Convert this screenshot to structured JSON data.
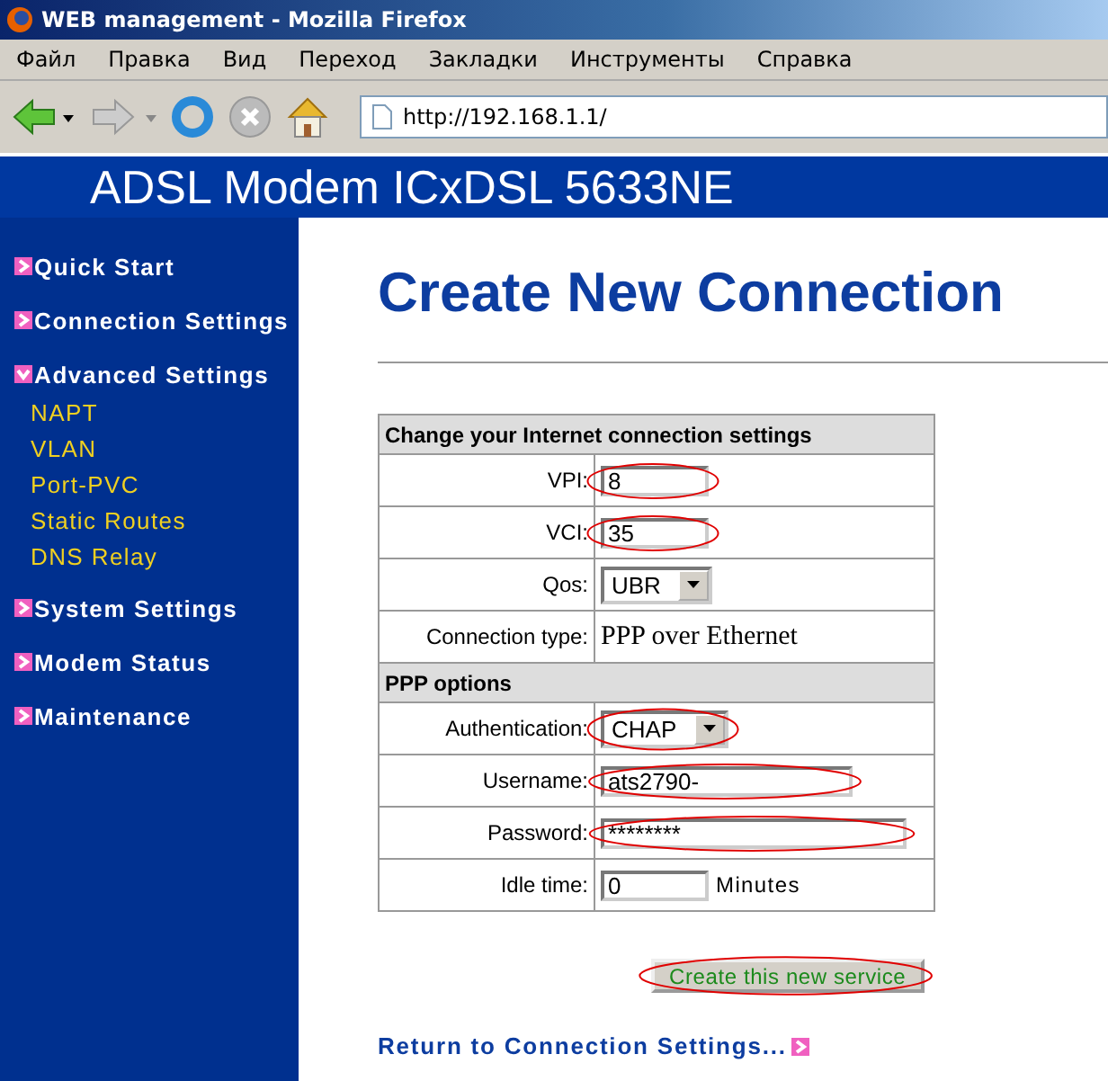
{
  "window": {
    "title": "WEB management - Mozilla Firefox"
  },
  "menu_bar": [
    "Файл",
    "Правка",
    "Вид",
    "Переход",
    "Закладки",
    "Инструменты",
    "Справка"
  ],
  "address_bar": {
    "value": "http://192.168.1.1/"
  },
  "header": {
    "title": "ADSL Modem ICxDSL 5633NE"
  },
  "sidebar": {
    "items": [
      {
        "label": "Quick Start",
        "expanded": false
      },
      {
        "label": "Connection Settings",
        "expanded": false
      },
      {
        "label": "Advanced Settings",
        "expanded": true,
        "children": [
          {
            "label": "NAPT"
          },
          {
            "label": "VLAN"
          },
          {
            "label": "Port-PVC"
          },
          {
            "label": "Static Routes"
          },
          {
            "label": "DNS Relay"
          }
        ]
      },
      {
        "label": "System Settings",
        "expanded": false
      },
      {
        "label": "Modem Status",
        "expanded": false
      },
      {
        "label": "Maintenance",
        "expanded": false
      }
    ]
  },
  "page": {
    "title": "Create New Connection"
  },
  "form": {
    "rows": [
      {
        "kind": "section",
        "label": "Change your Internet connection settings"
      },
      {
        "kind": "text",
        "label": "VPI:",
        "value": "8",
        "highlighted": true
      },
      {
        "kind": "text",
        "label": "VCI:",
        "value": "35",
        "highlighted": true
      },
      {
        "kind": "select",
        "label": "Qos:",
        "value": "UBR",
        "highlighted": false
      },
      {
        "kind": "static",
        "label": "Connection type:",
        "value": "PPP over Ethernet"
      },
      {
        "kind": "section",
        "label": "PPP options"
      },
      {
        "kind": "select",
        "label": "Authentication:",
        "value": "CHAP",
        "highlighted": true
      },
      {
        "kind": "text",
        "label": "Username:",
        "value": "ats2790-",
        "highlighted": true
      },
      {
        "kind": "text",
        "label": "Password:",
        "value": "********",
        "highlighted": true
      },
      {
        "kind": "text",
        "label": "Idle time:",
        "value": "0",
        "highlighted": false,
        "unit": "Minutes"
      }
    ]
  },
  "submit_button": {
    "label": "Create this new service",
    "highlighted": true
  },
  "return_link": {
    "label": "Return to Connection Settings..."
  }
}
